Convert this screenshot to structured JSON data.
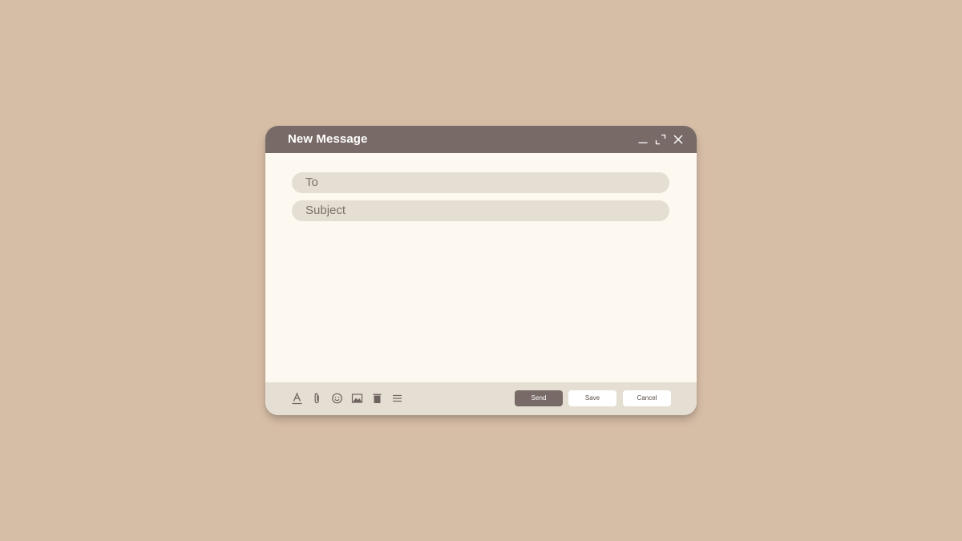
{
  "window": {
    "title": "New Message",
    "controls": {
      "minimize_icon": "minimize-icon",
      "maximize_icon": "maximize-icon",
      "close_icon": "close-icon"
    }
  },
  "compose": {
    "to_placeholder": "To",
    "to_value": "",
    "subject_placeholder": "Subject",
    "subject_value": "",
    "body_value": ""
  },
  "toolbar": {
    "tools": [
      {
        "icon": "text-format-icon"
      },
      {
        "icon": "paperclip-icon"
      },
      {
        "icon": "emoji-icon"
      },
      {
        "icon": "image-icon"
      },
      {
        "icon": "trash-icon"
      },
      {
        "icon": "menu-icon"
      }
    ],
    "send_label": "Send",
    "save_label": "Save",
    "cancel_label": "Cancel"
  },
  "colors": {
    "background": "#d6bda6",
    "titlebar": "#786a66",
    "window": "#fdf9f1",
    "field": "#e5ded2",
    "footer": "#e5ded2",
    "send_button": "#786a66",
    "text_muted": "#7b706b"
  }
}
